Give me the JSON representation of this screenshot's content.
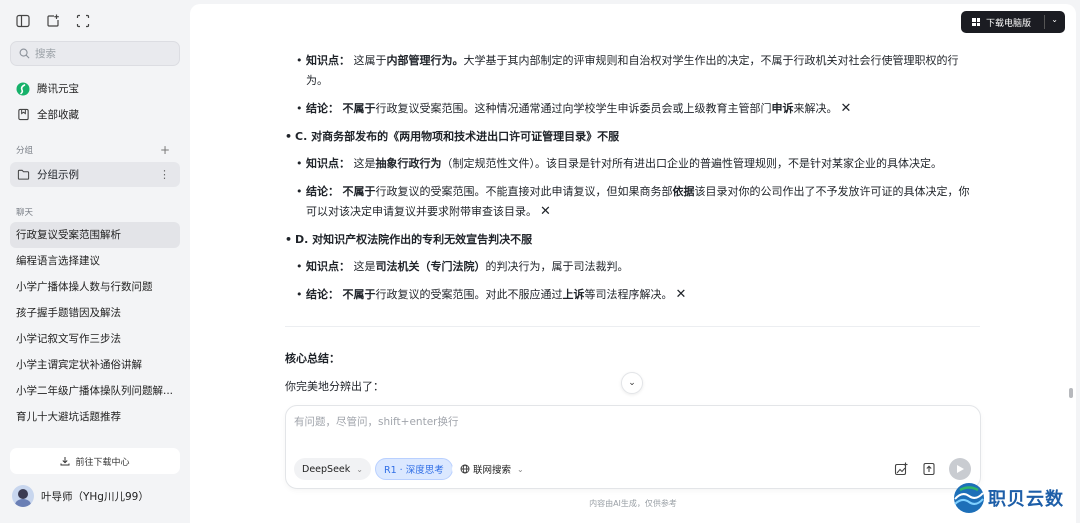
{
  "sidebar": {
    "search_placeholder": "搜索",
    "nav": [
      {
        "label": "腾讯元宝",
        "icon": "yuanbao-logo-icon"
      },
      {
        "label": "全部收藏",
        "icon": "bookmark-icon"
      }
    ],
    "groups_label": "分组",
    "group_item": "分组示例",
    "chats_label": "聊天",
    "chats": [
      "行政复议受案范围解析",
      "编程语言选择建议",
      "小学广播体操人数与行数问题",
      "孩子握手题错因及解法",
      "小学记叙文写作三步法",
      "小学主谓宾定状补通俗讲解",
      "小学二年级广播体操队列问题解...",
      "育儿十大避坑话题推荐"
    ],
    "download_center": "前往下载中心",
    "user_name": "叶导师（YHg川儿99）"
  },
  "header": {
    "download_label": "下载电脑版"
  },
  "content": {
    "b_knowledge": {
      "label": "知识点：",
      "pre": "这属于",
      "bold": "内部管理行为。",
      "post": "大学基于其内部制定的评审规则和自治权对学生作出的决定，不属于行政机关对社会行使管理职权的行为。"
    },
    "b_conclusion": {
      "label": "结论：",
      "bold1": "不属于",
      "mid": "行政复议受案范围。这种情况通常通过向学校学生申诉委员会或上级教育主管部门",
      "bold2": "申诉",
      "post": "来解决。"
    },
    "c_title": "C. 对商务部发布的《两用物项和技术进出口许可证管理目录》不服",
    "c_knowledge": {
      "label": "知识点：",
      "pre": "这是",
      "bold": "抽象行政行为",
      "post": "（制定规范性文件）。该目录是针对所有进出口企业的普遍性管理规则，不是针对某家企业的具体决定。"
    },
    "c_conclusion": {
      "label": "结论：",
      "bold1": "不属于",
      "mid": "行政复议的受案范围。不能直接对此申请复议，但如果商务部",
      "bold2": "依据",
      "post": "该目录对你的公司作出了不予发放许可证的具体决定，你可以对该决定申请复议并要求附带审查该目录。"
    },
    "d_title": "D. 对知识产权法院作出的专利无效宣告判决不服",
    "d_knowledge": {
      "label": "知识点：",
      "pre": "这是",
      "bold": "司法机关（专门法院）",
      "post": "的判决行为，属于司法裁判。"
    },
    "d_conclusion": {
      "label": "结论：",
      "bold1": "不属于",
      "mid": "行政复议的受案范围。对此不服应通过",
      "bold2": "上诉",
      "post": "等司法程序解决。"
    },
    "x_mark": "✕",
    "summary_title": "核心总结：",
    "summary_text": "你完美地分辨出了："
  },
  "composer": {
    "placeholder": "有问题，尽管问，shift+enter换行",
    "model": "DeepSeek",
    "deep_think": "R1 · 深度思考",
    "web_search": "联网搜索"
  },
  "footer": {
    "disclaimer": "内容由AI生成，仅供参考"
  },
  "watermark": {
    "text": "职贝云数"
  }
}
